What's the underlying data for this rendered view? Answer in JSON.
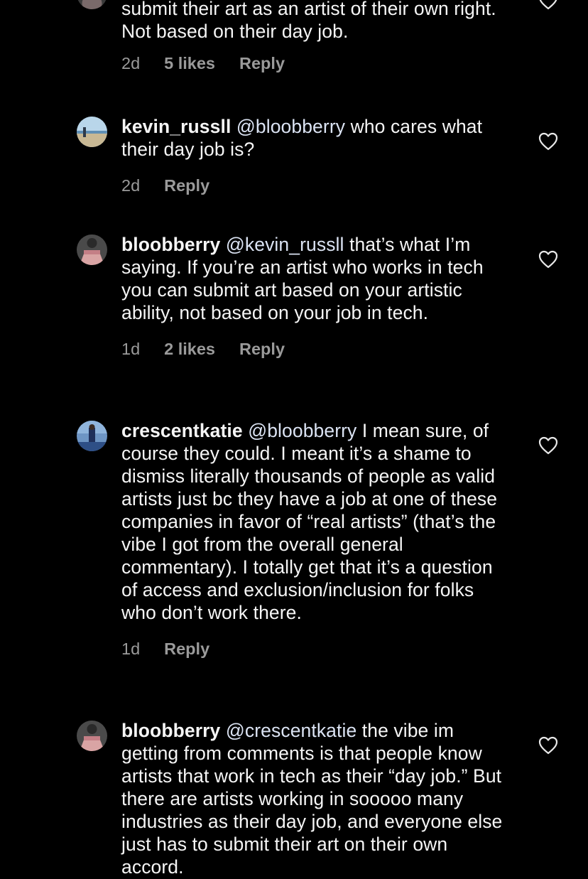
{
  "comments": [
    {
      "username": "",
      "mention": "",
      "text": "submit their art as an artist of their own right. Not based on their day job.",
      "time": "2d",
      "likes": "5 likes",
      "reply": "Reply"
    },
    {
      "username": "kevin_russll",
      "mention": "@bloobberry",
      "text": "who cares what their day job is?",
      "time": "2d",
      "likes": "",
      "reply": "Reply"
    },
    {
      "username": "bloobberry",
      "mention": "@kevin_russll",
      "text": "that’s what I’m saying. If you’re an artist who works in tech you can submit art based on your artistic ability, not based on your job in tech.",
      "time": "1d",
      "likes": "2 likes",
      "reply": "Reply"
    },
    {
      "username": "crescentkatie",
      "mention": "@bloobberry",
      "text": "I mean sure, of course they could. I meant it’s a shame to dismiss literally thousands of people as valid artists just bc they have a job at one of these companies in favor of “real artists” (that’s the vibe I got from the overall general commentary). I totally get that it’s a question of access and exclusion/inclusion for folks who don’t work there.",
      "time": "1d",
      "likes": "",
      "reply": "Reply"
    },
    {
      "username": "bloobberry",
      "mention": "@crescentkatie",
      "text": "the vibe im getting from comments is that people know artists that work in tech as their “day job.” But there are artists working in sooooo many industries as their day job, and everyone else just has to submit their art on their own accord.",
      "time": "",
      "likes": "",
      "reply": ""
    }
  ],
  "icons": {
    "like": "heart-outline-icon",
    "avatar": "user-avatar"
  },
  "colors": {
    "background": "#000000",
    "text": "#f5f5f5",
    "meta": "#9a9a9a",
    "mention": "#dbe3f3"
  }
}
